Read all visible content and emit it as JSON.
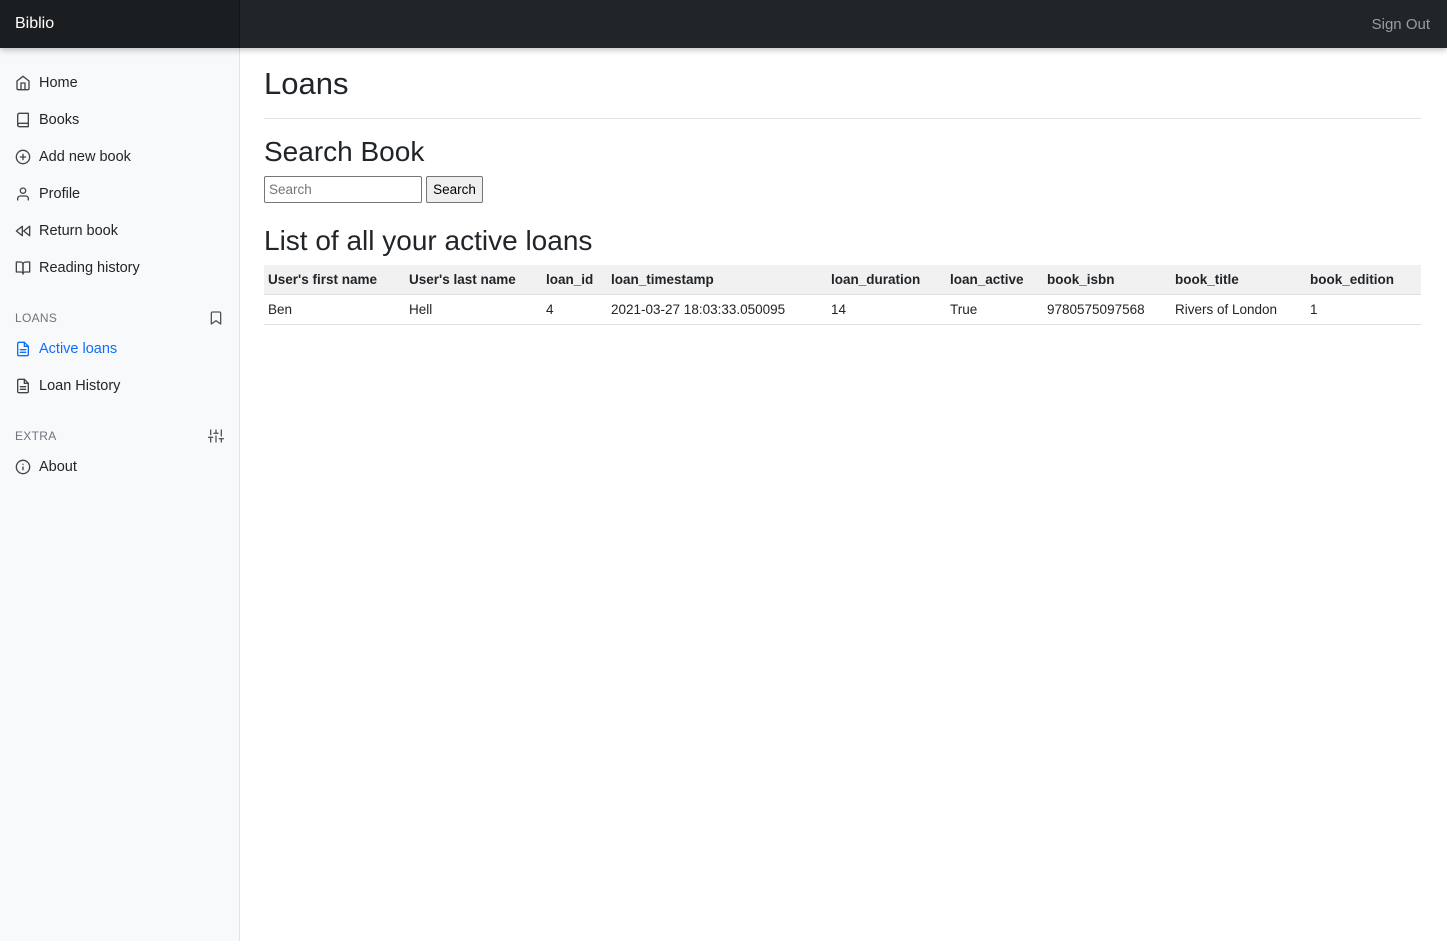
{
  "topbar": {
    "brand": "Biblio",
    "sign_out": "Sign Out"
  },
  "sidebar": {
    "items": [
      {
        "label": "Home",
        "icon": "home-icon"
      },
      {
        "label": "Books",
        "icon": "book-icon"
      },
      {
        "label": "Add new book",
        "icon": "plus-circle-icon"
      },
      {
        "label": "Profile",
        "icon": "user-icon"
      },
      {
        "label": "Return book",
        "icon": "rewind-icon"
      },
      {
        "label": "Reading history",
        "icon": "book-open-icon"
      }
    ],
    "loans_section": {
      "title": "LOANS",
      "icon": "bookmark-icon",
      "items": [
        {
          "label": "Active loans",
          "icon": "file-text-icon",
          "active": true
        },
        {
          "label": "Loan History",
          "icon": "file-text-icon",
          "active": false
        }
      ]
    },
    "extra_section": {
      "title": "EXTRA",
      "icon": "sliders-icon",
      "items": [
        {
          "label": "About",
          "icon": "info-icon"
        }
      ]
    }
  },
  "main": {
    "page_title": "Loans",
    "search_heading": "Search Book",
    "search_placeholder": "Search",
    "search_button": "Search",
    "list_heading": "List of all your active loans",
    "table": {
      "columns": [
        "User's first name",
        "User's last name",
        "loan_id",
        "loan_timestamp",
        "loan_duration",
        "loan_active",
        "book_isbn",
        "book_title",
        "book_edition"
      ],
      "rows": [
        [
          "Ben",
          "Hell",
          "4",
          "2021-03-27 18:03:33.050095",
          "14",
          "True",
          "9780575097568",
          "Rivers of London",
          "1"
        ]
      ]
    }
  },
  "colors": {
    "topbar": "#212529",
    "sidebar": "#f8f9fa",
    "active_link": "#0d6efd"
  }
}
